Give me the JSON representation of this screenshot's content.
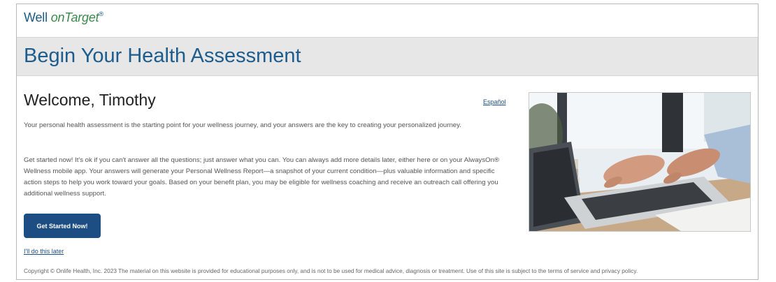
{
  "brand": {
    "part1": "Well ",
    "part2": "onTarget",
    "trademark": "®"
  },
  "banner": {
    "title": "Begin Your Health Assessment"
  },
  "main": {
    "welcome": "Welcome, Timothy",
    "language_link": "Español",
    "paragraph1": "Your personal health assessment is the starting point for your wellness journey, and your answers are the key to creating your personalized journey.",
    "paragraph2": "Get started now! It's ok if you can't answer all the questions; just answer what you can. You can always add more details later, either here or on your AlwaysOn® Wellness mobile app. Your answers will generate your Personal Wellness Report—a snapshot of your current condition—plus valuable information and specific action steps to help you work toward your goals. Based on your benefit plan, you may be eligible for wellness coaching and receive an outreach call offering you additional wellness support.",
    "cta_label": "Get Started Now!",
    "later_link": "I'll do this later"
  },
  "footer": {
    "copyright": "Copyright © Onlife Health, Inc. 2023 The material on this website is provided for educational purposes only, and is not to be used for medical advice, diagnosis or treatment. Use of this site is subject to the terms of service and privacy policy."
  },
  "image": {
    "icon": "laptop-typing-photo"
  },
  "colors": {
    "brand_blue": "#1d5d8e",
    "button_blue": "#1c4d83",
    "banner_bg": "#e7e7e7",
    "brand_green": "#3a8b4a"
  }
}
